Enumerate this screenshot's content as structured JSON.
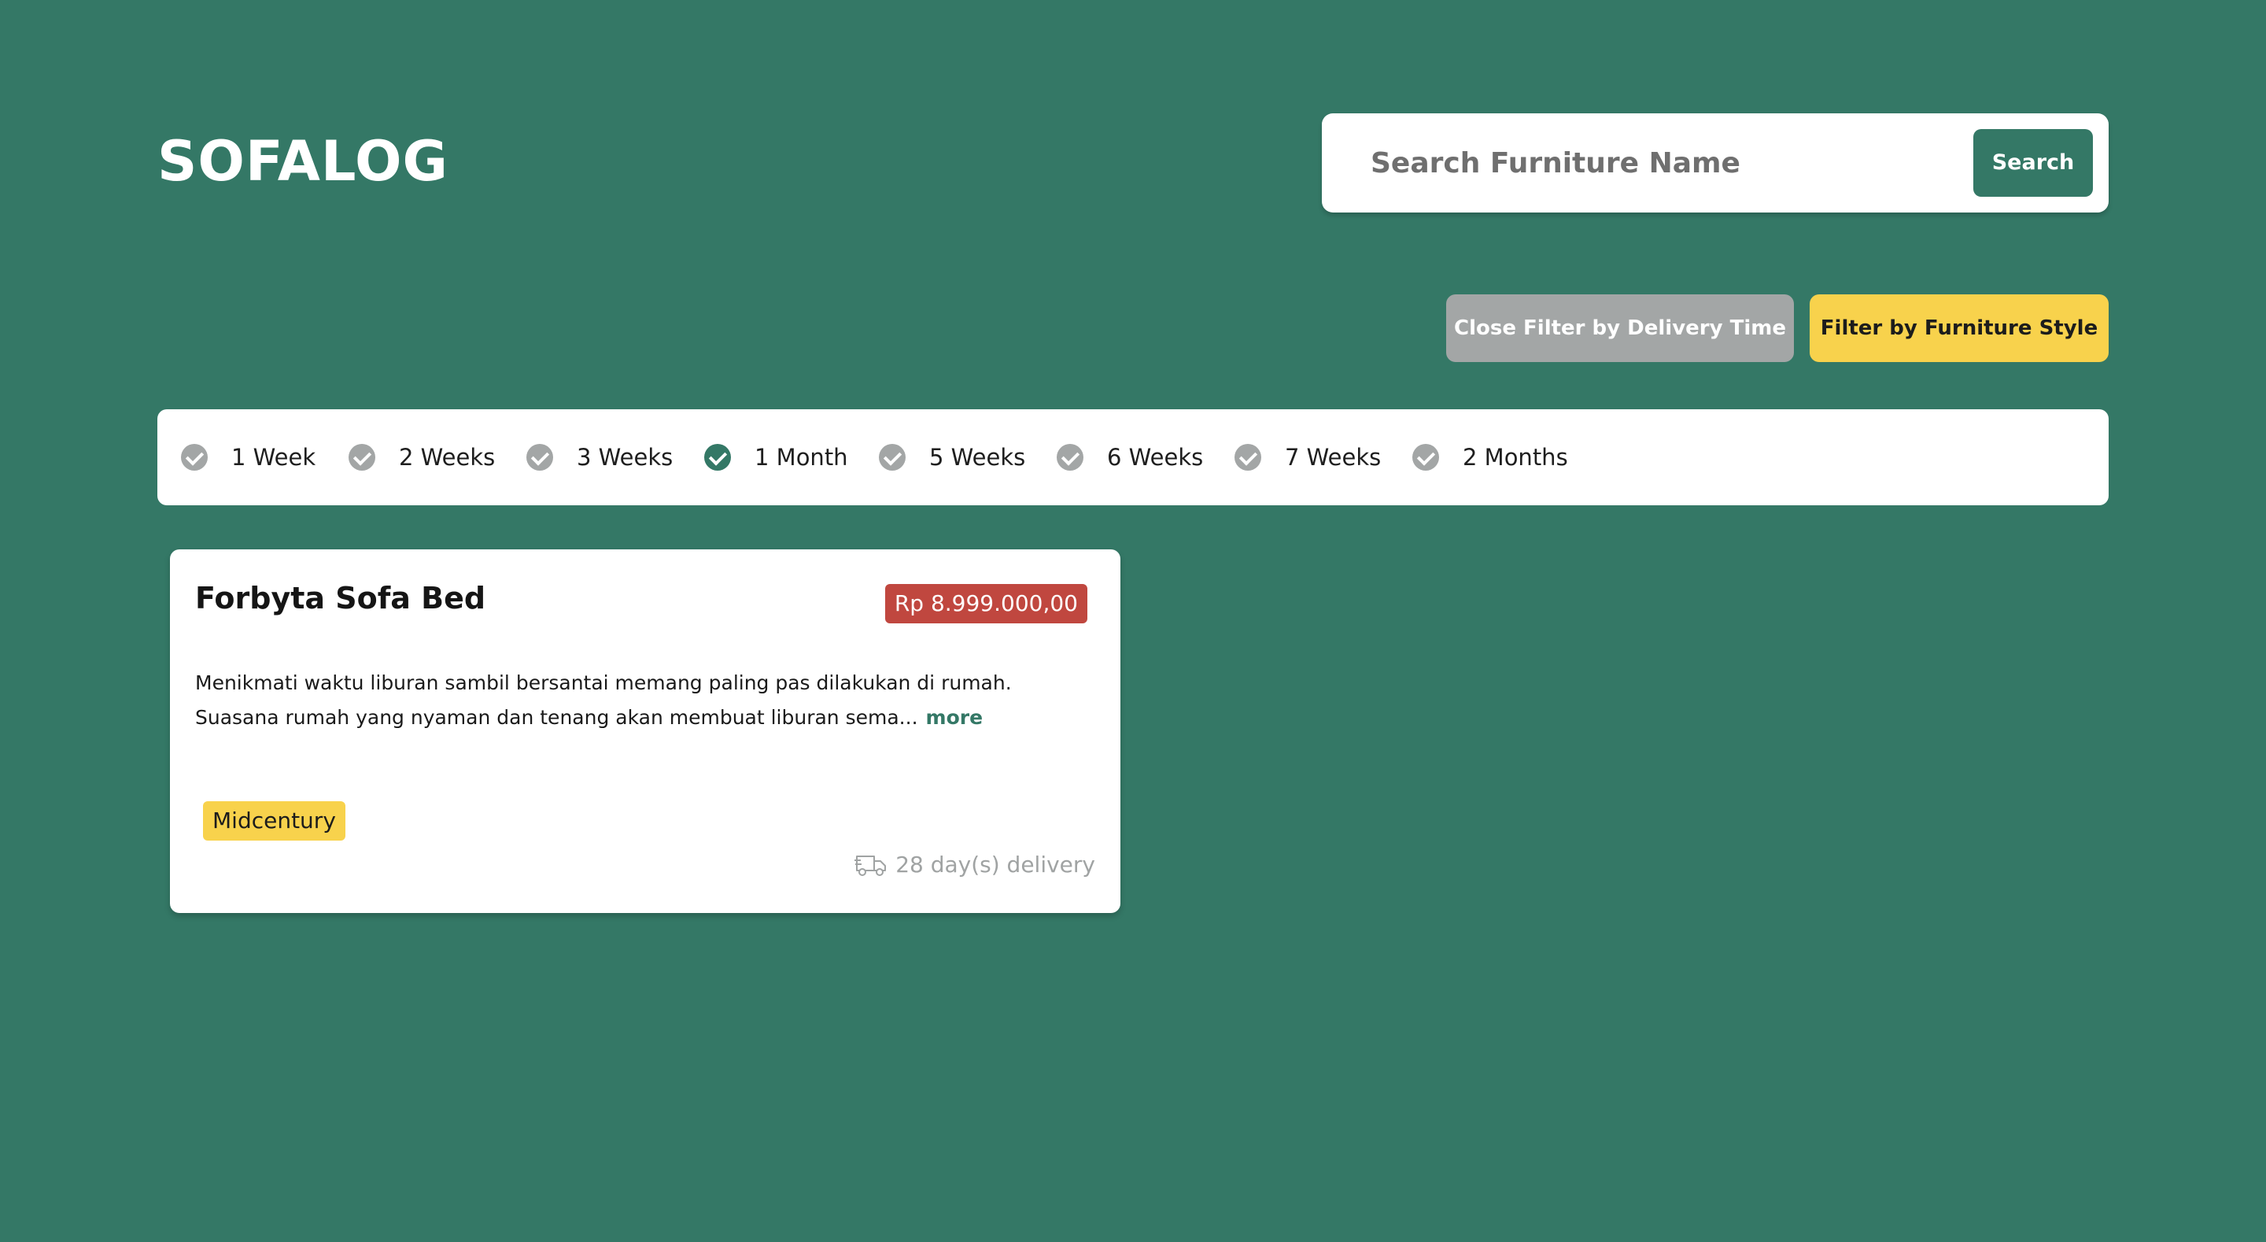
{
  "header": {
    "brand": "SOFALOG"
  },
  "search": {
    "placeholder": "Search Furniture Name",
    "value": "",
    "button_label": "Search"
  },
  "toolbar": {
    "close_delivery_filter_label": "Close Filter by Delivery Time",
    "style_filter_label": "Filter by Furniture Style"
  },
  "delivery_filter": {
    "options": [
      {
        "label": "1 Week",
        "checked": false
      },
      {
        "label": "2 Weeks",
        "checked": false
      },
      {
        "label": "3 Weeks",
        "checked": false
      },
      {
        "label": "1 Month",
        "checked": true
      },
      {
        "label": "5 Weeks",
        "checked": false
      },
      {
        "label": "6 Weeks",
        "checked": false
      },
      {
        "label": "7 Weeks",
        "checked": false
      },
      {
        "label": "2 Months",
        "checked": false
      }
    ]
  },
  "products": [
    {
      "name": "Forbyta Sofa Bed",
      "price": "Rp 8.999.000,00",
      "description": "Menikmati waktu liburan sambil bersantai memang paling pas dilakukan di rumah. Suasana rumah yang nyaman dan tenang akan membuat liburan sema...",
      "more_label": "more",
      "style_tag": "Midcentury",
      "delivery": "28 day(s) delivery"
    }
  ],
  "icons": {
    "check": "check-circle-icon",
    "delivery": "truck-icon"
  },
  "colors": {
    "background": "#347866",
    "primary": "#347866",
    "inactive": "#a3a6a6",
    "accent_yellow": "#f8d24c",
    "price_red": "#c0473f",
    "muted_text": "#a0a3a3"
  }
}
